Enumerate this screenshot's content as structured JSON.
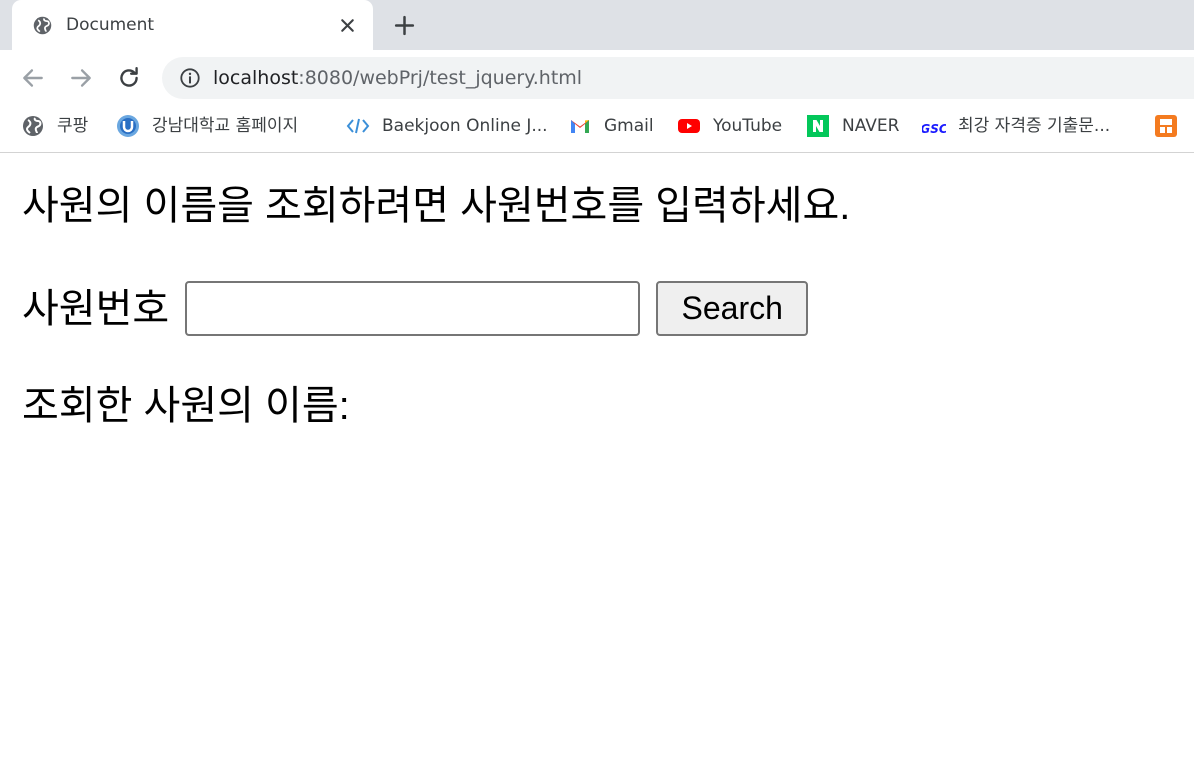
{
  "browser": {
    "tab": {
      "title": "Document"
    },
    "address": {
      "host": "localhost",
      "rest": ":8080/webPrj/test_jquery.html"
    },
    "bookmarks": [
      {
        "label": "쿠팡",
        "icon": "globe-icon"
      },
      {
        "label": "강남대학교 홈페이지",
        "icon": "university-logo-icon"
      },
      {
        "label": "Baekjoon Online J...",
        "icon": "code-brackets-icon"
      },
      {
        "label": "Gmail",
        "icon": "gmail-icon"
      },
      {
        "label": "YouTube",
        "icon": "youtube-icon"
      },
      {
        "label": "NAVER",
        "icon": "naver-icon"
      },
      {
        "label": "최강 자격증 기출문...",
        "icon": "gsc-icon"
      },
      {
        "label": "",
        "icon": "orange-app-icon"
      }
    ]
  },
  "page": {
    "prompt": "사원의 이름을 조회하려면 사원번호를 입력하세요.",
    "form": {
      "label": "사원번호",
      "input_value": "",
      "search_label": "Search"
    },
    "result_label": "조회한 사원의 이름:"
  },
  "colors": {
    "tabstrip": "#dee1e6",
    "omnibox": "#f1f3f4",
    "youtube": "#ff0000",
    "naver": "#03c75a",
    "gsc": "#1a1aff"
  }
}
